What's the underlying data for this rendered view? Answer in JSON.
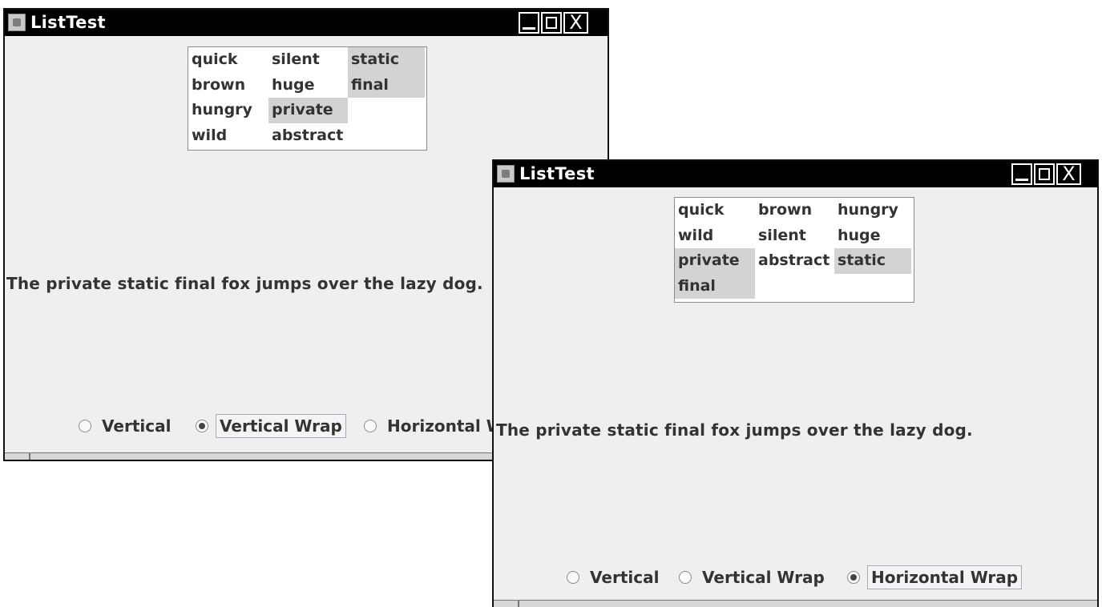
{
  "windows": [
    {
      "title": "ListTest",
      "controls": {
        "minimize": "_",
        "maximize": "□",
        "close": "X"
      },
      "list_items": [
        {
          "text": "quick",
          "selected": false
        },
        {
          "text": "brown",
          "selected": false
        },
        {
          "text": "hungry",
          "selected": false
        },
        {
          "text": "wild",
          "selected": false
        },
        {
          "text": "silent",
          "selected": false
        },
        {
          "text": "huge",
          "selected": false
        },
        {
          "text": "private",
          "selected": true
        },
        {
          "text": "abstract",
          "selected": false
        },
        {
          "text": "static",
          "selected": true
        },
        {
          "text": "final",
          "selected": true
        },
        {
          "text": "",
          "selected": false
        },
        {
          "text": "",
          "selected": false
        }
      ],
      "sentence": "The private static final fox jumps over the lazy dog.",
      "radios": [
        {
          "label": "Vertical",
          "checked": false
        },
        {
          "label": "Vertical Wrap",
          "checked": true
        },
        {
          "label": "Horizontal Wrap",
          "checked": false
        }
      ]
    },
    {
      "title": "ListTest",
      "controls": {
        "minimize": "_",
        "maximize": "□",
        "close": "X"
      },
      "list_items": [
        {
          "text": "quick",
          "selected": false
        },
        {
          "text": "brown",
          "selected": false
        },
        {
          "text": "hungry",
          "selected": false
        },
        {
          "text": "wild",
          "selected": false
        },
        {
          "text": "silent",
          "selected": false
        },
        {
          "text": "huge",
          "selected": false
        },
        {
          "text": "private",
          "selected": true
        },
        {
          "text": "abstract",
          "selected": false
        },
        {
          "text": "static",
          "selected": true
        },
        {
          "text": "final",
          "selected": true
        },
        {
          "text": "",
          "selected": false
        },
        {
          "text": "",
          "selected": false
        }
      ],
      "sentence": "The private static final fox jumps over the lazy dog.",
      "radios": [
        {
          "label": "Vertical",
          "checked": false
        },
        {
          "label": "Vertical Wrap",
          "checked": false
        },
        {
          "label": "Horizontal Wrap",
          "checked": true
        }
      ]
    }
  ]
}
